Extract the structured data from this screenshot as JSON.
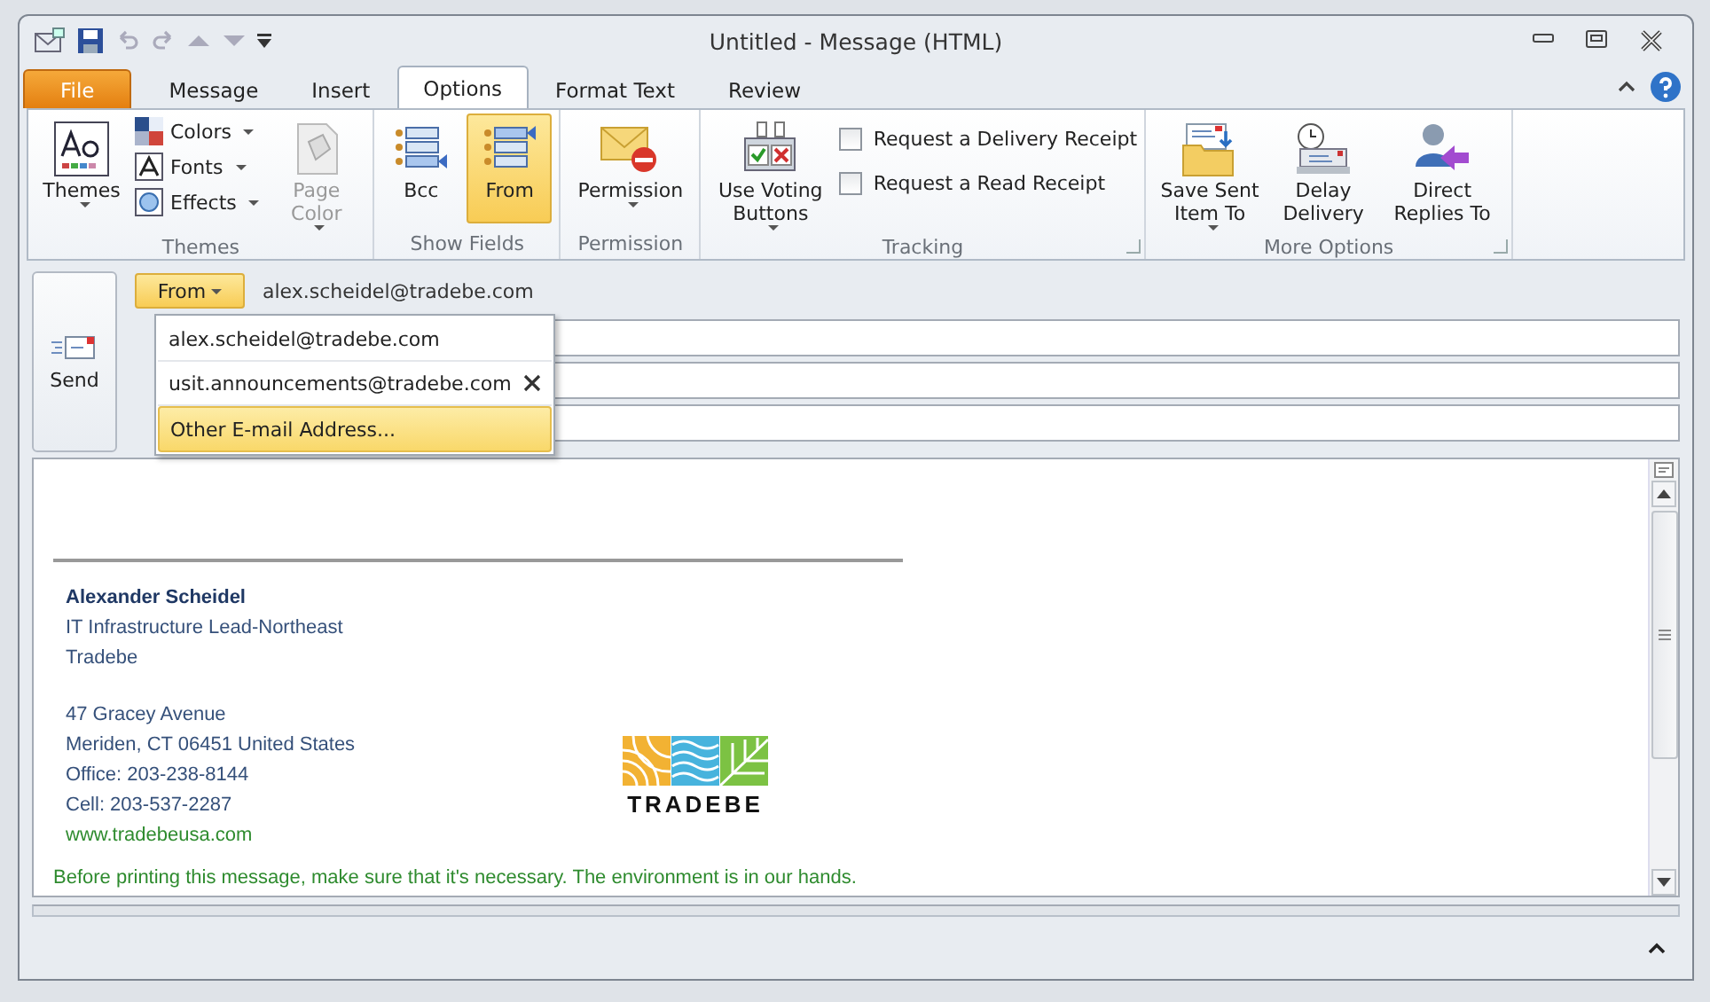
{
  "window": {
    "title": "Untitled  -  Message (HTML)"
  },
  "tabs": [
    {
      "label": "File",
      "kind": "file",
      "selected": false
    },
    {
      "label": "Message",
      "kind": "tab",
      "selected": false
    },
    {
      "label": "Insert",
      "kind": "tab",
      "selected": false
    },
    {
      "label": "Options",
      "kind": "tab",
      "selected": true
    },
    {
      "label": "Format Text",
      "kind": "tab",
      "selected": false
    },
    {
      "label": "Review",
      "kind": "tab",
      "selected": false
    }
  ],
  "ribbon_groups": [
    {
      "label": "Themes",
      "launcher": false,
      "items": [
        {
          "kind": "large",
          "label": "Themes",
          "dropdown": true,
          "disabled": false,
          "selected": false
        },
        {
          "kind": "stack",
          "entries": [
            {
              "label": "Colors",
              "dropdown": true
            },
            {
              "label": "Fonts",
              "dropdown": true
            },
            {
              "label": "Effects",
              "dropdown": true
            }
          ]
        },
        {
          "kind": "large",
          "label": "Page Color",
          "dropdown": true,
          "disabled": true,
          "selected": false
        }
      ]
    },
    {
      "label": "Show Fields",
      "launcher": false,
      "items": [
        {
          "kind": "large",
          "label": "Bcc",
          "dropdown": false,
          "disabled": false,
          "selected": false
        },
        {
          "kind": "large",
          "label": "From",
          "dropdown": false,
          "disabled": false,
          "selected": true
        }
      ]
    },
    {
      "label": "Permission",
      "launcher": false,
      "items": [
        {
          "kind": "large",
          "label": "Permission",
          "dropdown": true,
          "disabled": false,
          "selected": false
        }
      ]
    },
    {
      "label": "Tracking",
      "launcher": true,
      "items": [
        {
          "kind": "large",
          "label": "Use Voting Buttons",
          "dropdown": true,
          "disabled": false,
          "selected": false
        },
        {
          "kind": "checks",
          "entries": [
            {
              "label": "Request a Delivery Receipt",
              "checked": false
            },
            {
              "label": "Request a Read Receipt",
              "checked": false
            }
          ]
        }
      ]
    },
    {
      "label": "More Options",
      "launcher": true,
      "items": [
        {
          "kind": "large",
          "label": "Save Sent Item To",
          "dropdown": true,
          "disabled": false,
          "selected": false
        },
        {
          "kind": "large",
          "label": "Delay Delivery",
          "dropdown": false,
          "disabled": false,
          "selected": false
        },
        {
          "kind": "large",
          "label": "Direct Replies To",
          "dropdown": false,
          "disabled": false,
          "selected": false
        }
      ]
    }
  ],
  "compose": {
    "send_label": "Send",
    "from_label": "From",
    "from_value": "alex.scheidel@tradebe.com",
    "from_menu": [
      {
        "label": "alex.scheidel@tradebe.com",
        "removable": false,
        "selected": false
      },
      {
        "label": "usit.announcements@tradebe.com",
        "removable": true,
        "selected": false
      },
      {
        "label": "Other E-mail Address...",
        "removable": false,
        "selected": true
      }
    ]
  },
  "signature": {
    "lines": [
      {
        "kind": "name",
        "text": "Alexander Scheidel"
      },
      {
        "kind": "text",
        "text": "IT Infrastructure Lead-Northeast"
      },
      {
        "kind": "text",
        "text": "Tradebe"
      },
      {
        "kind": "gap"
      },
      {
        "kind": "text",
        "text": "47 Gracey Avenue"
      },
      {
        "kind": "text",
        "text": "Meriden, CT 06451 United States"
      },
      {
        "kind": "text",
        "text": "Office: 203-238-8144"
      },
      {
        "kind": "text",
        "text": "Cell: 203-537-2287"
      },
      {
        "kind": "link",
        "text": "www.tradebeusa.com"
      }
    ],
    "logo_text": "TRADEBE",
    "footer": "Before printing this message, make sure that it's necessary. The environment is in our hands."
  }
}
